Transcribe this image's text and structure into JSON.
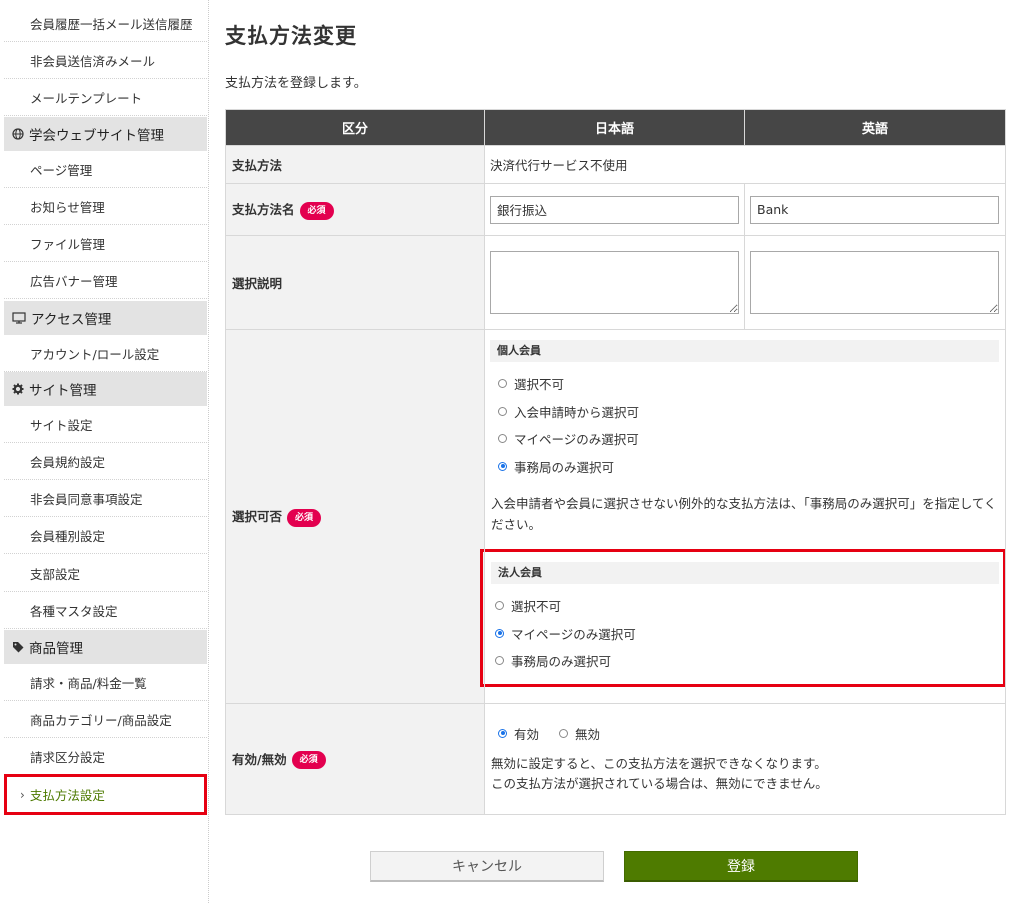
{
  "sidebar": {
    "items": [
      {
        "label": "会員履歴一括メール送信履歴"
      },
      {
        "label": "非会員送信済みメール"
      },
      {
        "label": "メールテンプレート"
      }
    ],
    "sections": [
      {
        "title": "学会ウェブサイト管理",
        "icon": "globe-icon",
        "items": [
          {
            "label": "ページ管理"
          },
          {
            "label": "お知らせ管理"
          },
          {
            "label": "ファイル管理"
          },
          {
            "label": "広告バナー管理"
          }
        ]
      },
      {
        "title": "アクセス管理",
        "icon": "monitor-icon",
        "items": [
          {
            "label": "アカウント/ロール設定"
          }
        ]
      },
      {
        "title": "サイト管理",
        "icon": "gear-icon",
        "items": [
          {
            "label": "サイト設定"
          },
          {
            "label": "会員規約設定"
          },
          {
            "label": "非会員同意事項設定"
          },
          {
            "label": "会員種別設定"
          },
          {
            "label": "支部設定"
          },
          {
            "label": "各種マスタ設定"
          }
        ]
      },
      {
        "title": "商品管理",
        "icon": "tag-icon",
        "items": [
          {
            "label": "請求・商品/料金一覧"
          },
          {
            "label": "商品カテゴリー/商品設定"
          },
          {
            "label": "請求区分設定"
          },
          {
            "label": "支払方法設定",
            "active": true
          }
        ]
      }
    ]
  },
  "main": {
    "title": "支払方法変更",
    "description": "支払方法を登録します。",
    "table": {
      "headers": [
        "区分",
        "日本語",
        "英語"
      ],
      "payment_method": {
        "label": "支払方法",
        "value": "決済代行サービス不使用"
      },
      "payment_name": {
        "label": "支払方法名",
        "ja_value": "銀行振込",
        "en_value": "Bank"
      },
      "description_row": {
        "label": "選択説明",
        "ja_value": "",
        "en_value": ""
      },
      "selectable": {
        "label": "選択可否",
        "individual": {
          "heading": "個人会員",
          "options": [
            "選択不可",
            "入会申請時から選択可",
            "マイページのみ選択可",
            "事務局のみ選択可"
          ],
          "selected": "事務局のみ選択可",
          "note": "入会申請者や会員に選択させない例外的な支払方法は、「事務局のみ選択可」を指定してください。"
        },
        "corporate": {
          "heading": "法人会員",
          "options": [
            "選択不可",
            "マイページのみ選択可",
            "事務局のみ選択可"
          ],
          "selected": "マイページのみ選択可"
        }
      },
      "enabled": {
        "label": "有効/無効",
        "options": [
          "有効",
          "無効"
        ],
        "selected": "有効",
        "note_line1": "無効に設定すると、この支払方法を選択できなくなります。",
        "note_line2": "この支払方法が選択されている場合は、無効にできません。"
      },
      "required_badge": "必須"
    }
  },
  "buttons": {
    "cancel": "キャンセル",
    "submit": "登録"
  },
  "colors": {
    "header_bg": "#464646",
    "accent_green": "#4e7b00",
    "required_red": "#e3004f",
    "highlight_red": "#e60012"
  }
}
